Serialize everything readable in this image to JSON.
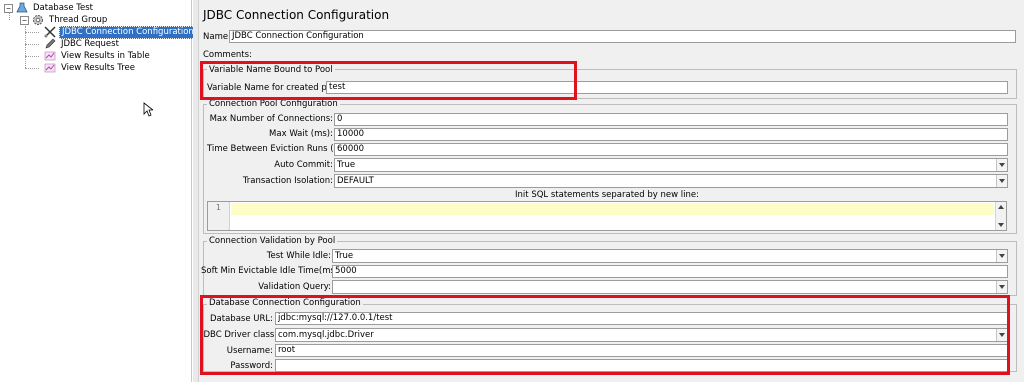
{
  "tree": {
    "root": "Database Test",
    "thread_group": "Thread Group",
    "items": [
      {
        "label": "JDBC Connection Configuration",
        "selected": true,
        "icon": "wrench-scissors-icon"
      },
      {
        "label": "JDBC Request",
        "selected": false,
        "icon": "pen-icon"
      },
      {
        "label": "View Results in Table",
        "selected": false,
        "icon": "chart-icon"
      },
      {
        "label": "View Results Tree",
        "selected": false,
        "icon": "chart-icon"
      }
    ]
  },
  "panel": {
    "title": "JDBC Connection Configuration",
    "name_label": "Name:",
    "name_value": "JDBC Connection Configuration",
    "comments_label": "Comments:"
  },
  "pool_binding": {
    "legend": "Variable Name Bound to Pool",
    "var_label": "Variable Name for created pool:",
    "var_value": "test"
  },
  "pool_config": {
    "legend": "Connection Pool Configuration",
    "max_conn_label": "Max Number of Connections:",
    "max_conn_value": "0",
    "max_wait_label": "Max Wait (ms):",
    "max_wait_value": "10000",
    "eviction_label": "Time Between Eviction Runs (ms):",
    "eviction_value": "60000",
    "auto_commit_label": "Auto Commit:",
    "auto_commit_value": "True",
    "isolation_label": "Transaction Isolation:",
    "isolation_value": "DEFAULT",
    "init_sql_label": "Init SQL statements separated by new line:",
    "init_sql_line": "1"
  },
  "validation": {
    "legend": "Connection Validation by Pool",
    "test_idle_label": "Test While Idle:",
    "test_idle_value": "True",
    "soft_min_label": "Soft Min Evictable Idle Time(ms):",
    "soft_min_value": "5000",
    "query_label": "Validation Query:",
    "query_value": ""
  },
  "db_conn": {
    "legend": "Database Connection Configuration",
    "url_label": "Database URL:",
    "url_value": "jdbc:mysql://127.0.0.1/test",
    "driver_label": "JDBC Driver class:",
    "driver_value": "com.mysql.jdbc.Driver",
    "user_label": "Username:",
    "user_value": "root",
    "pass_label": "Password:",
    "pass_value": ""
  },
  "colors": {
    "highlight": "#e0101e",
    "selection": "#2f6fc4",
    "sql_line": "#fdfdc5"
  }
}
